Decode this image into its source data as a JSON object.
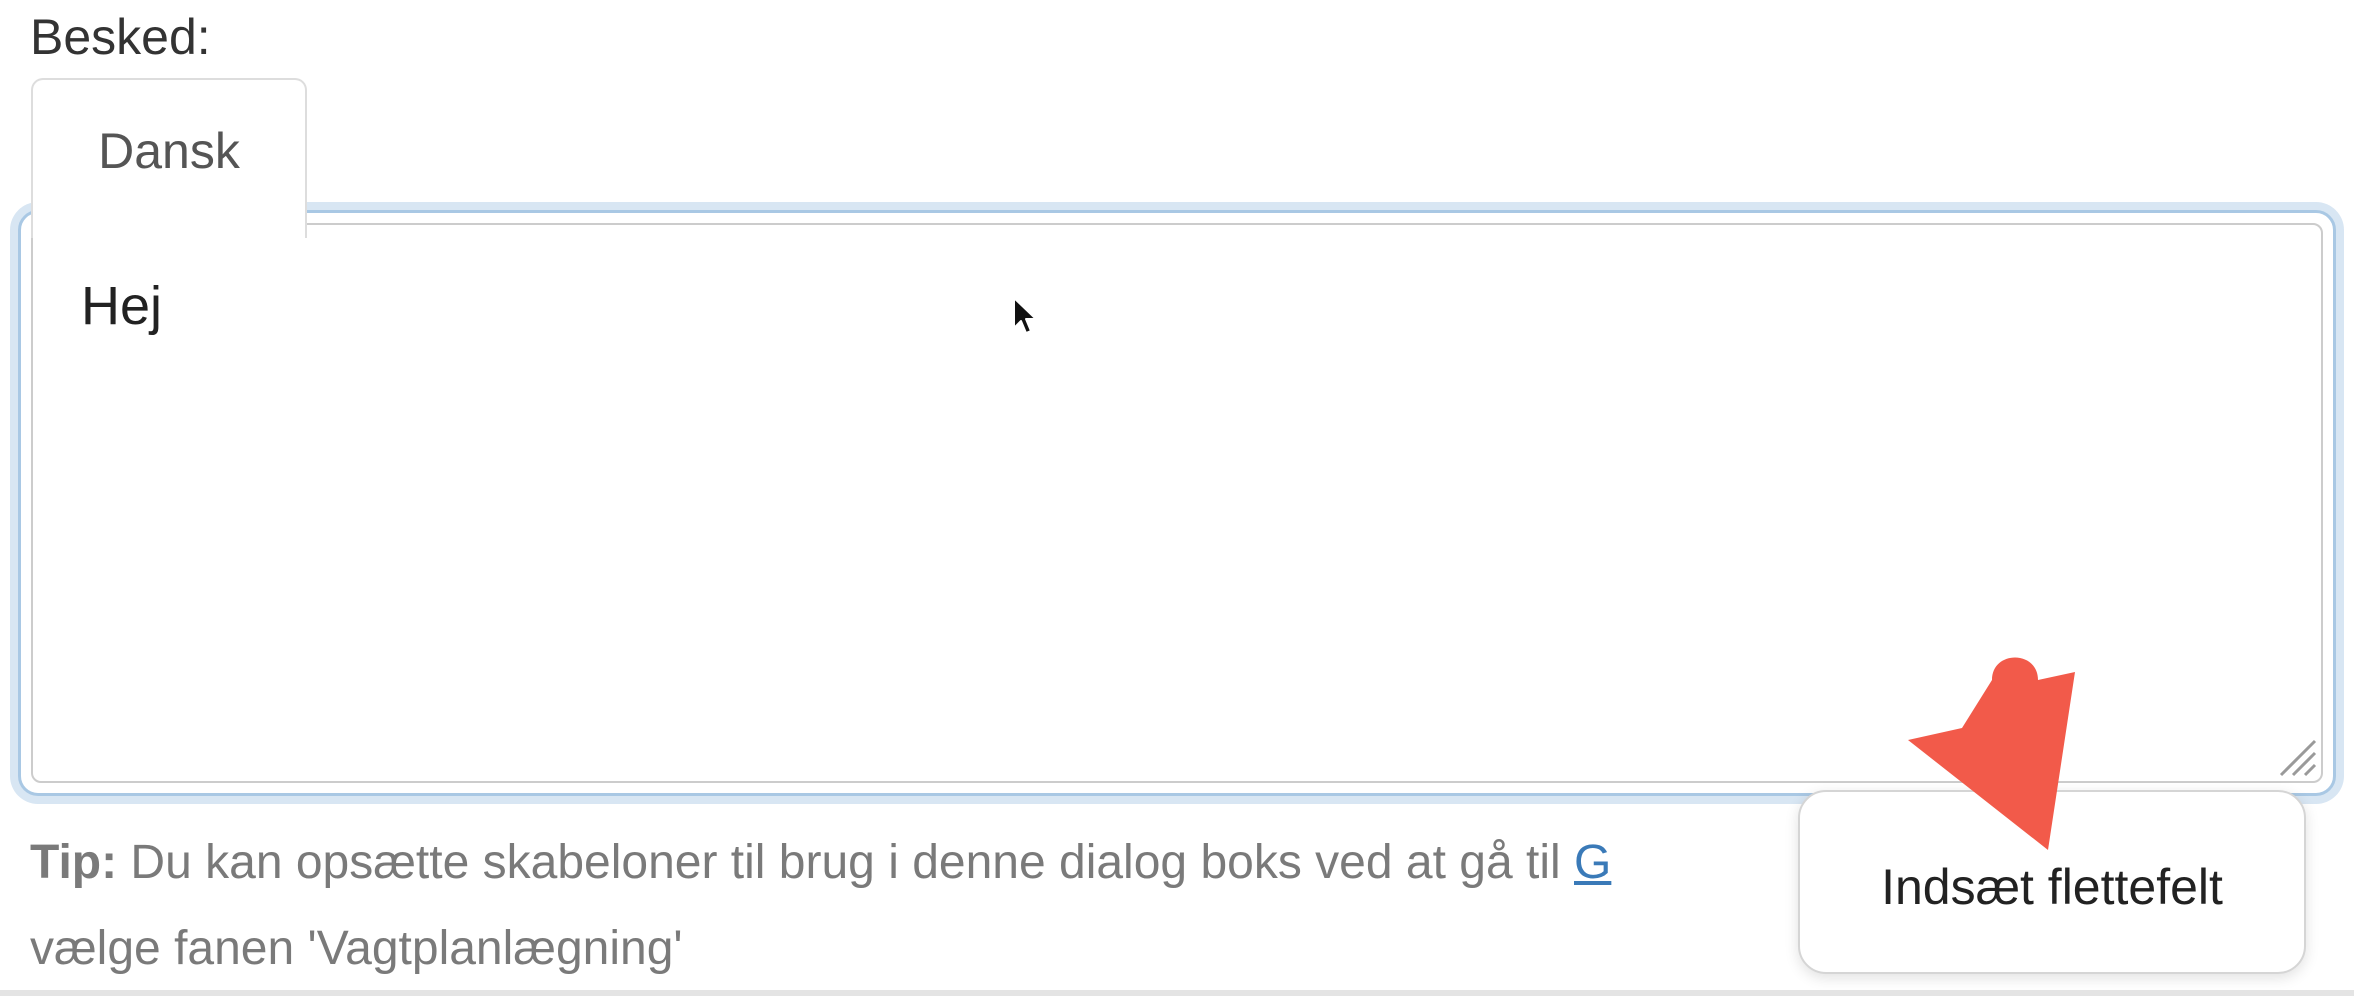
{
  "form": {
    "label": "Besked:",
    "tabs": [
      {
        "label": "Dansk"
      }
    ],
    "editor": {
      "value": "Hej"
    },
    "tip": {
      "prefix": "Tip:",
      "text_before_link": " Du kan opsætte skabeloner til brug i denne dialog boks ved at gå til ",
      "link": "G",
      "text_after_link": "",
      "line2": "vælge fanen 'Vagtplanlægning'"
    }
  },
  "popup": {
    "label": "Indsæt flettefelt"
  },
  "colors": {
    "focus_ring": "#a9c8e4",
    "link": "#3a7ab8",
    "arrow": "#f25a4a"
  },
  "icons": {
    "cursor": "mouse-pointer-icon",
    "resize": "resize-grip-icon",
    "arrow": "annotation-arrow-icon"
  }
}
